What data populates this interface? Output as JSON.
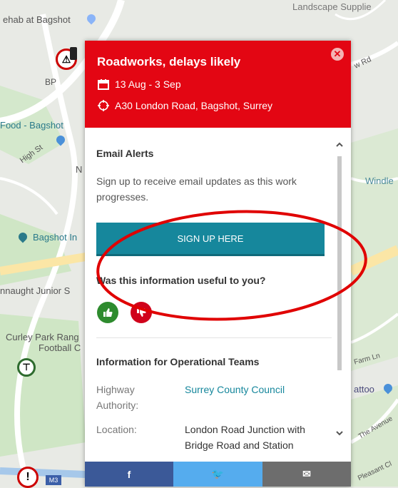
{
  "map": {
    "labels": {
      "landscape": "Landscape Supplie",
      "rehab": "ehab at Bagshot",
      "bp": "BP",
      "food": "Food - Bagshot",
      "high_st": "High St",
      "n": "N",
      "rd": "w Rd",
      "windle": "Windle",
      "bagshot_inn": "Bagshot In",
      "nnaught": "nnaught Junior S",
      "curley": "Curley Park Rang",
      "football": "Football C",
      "farm": "Farm Ln",
      "attoo": "attoo",
      "avenue": "The Avenue",
      "pleasant": "Pleasant Cl",
      "m3": "M3"
    }
  },
  "popup": {
    "title": "Roadworks, delays likely",
    "dates": "13 Aug - 3 Sep",
    "location": "A30 London Road, Bagshot, Surrey",
    "close_symbol": "✕",
    "email_alerts": {
      "title": "Email Alerts",
      "text": "Sign up to receive email updates as this work progresses.",
      "button": "SIGN UP HERE"
    },
    "feedback": {
      "question": "Was this information useful to you?"
    },
    "operational": {
      "title": "Information for Operational Teams",
      "rows": [
        {
          "key": "Highway Authority:",
          "value": "Surrey County Council"
        },
        {
          "key": "Location:",
          "value": "London Road Junction with Bridge Road and Station"
        }
      ]
    },
    "share": {
      "facebook": "f",
      "twitter": "🐦",
      "email": "✉"
    }
  },
  "colors": {
    "header": "#e30613",
    "teal": "#16879c",
    "thumbs_up": "#2e8b2e",
    "thumbs_down": "#d0021b",
    "facebook": "#3b5998",
    "twitter": "#55acee",
    "email": "#6d6d6d",
    "annotation": "#e00000"
  }
}
